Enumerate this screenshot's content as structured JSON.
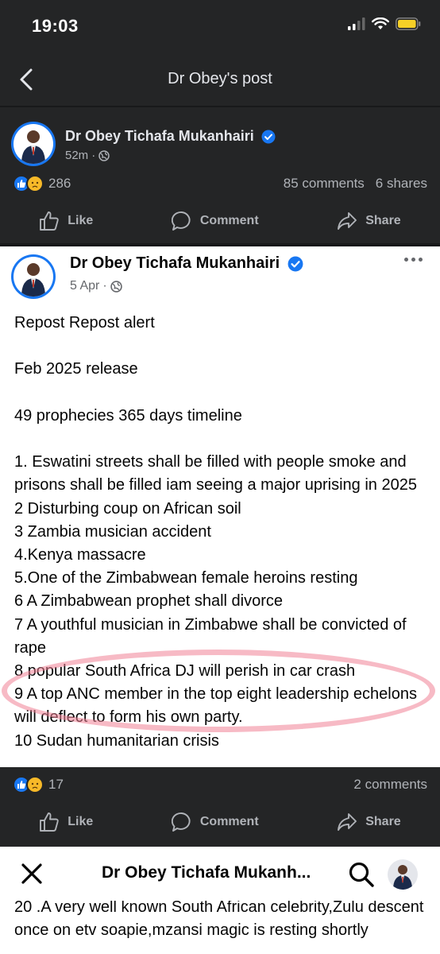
{
  "status_bar": {
    "time": "19:03"
  },
  "header": {
    "title": "Dr Obey's post"
  },
  "post": {
    "author": "Dr Obey Tichafa Mukanhairi",
    "time": "52m",
    "reaction_count": "286",
    "comments": "85 comments",
    "shares": "6 shares"
  },
  "actions": {
    "like": "Like",
    "comment": "Comment",
    "share": "Share"
  },
  "shared_post": {
    "author": "Dr Obey Tichafa Mukanhairi",
    "date": "5 Apr",
    "lines": [
      "Repost Repost alert",
      "",
      "Feb 2025 release",
      "",
      "49 prophecies 365 days timeline",
      "",
      "1. Eswatini streets shall be filled with people smoke and prisons shall be filled iam seeing a major uprising in 2025",
      "2 Disturbing coup on African soil",
      "3 Zambia musician accident",
      "4.Kenya massacre",
      "5.One of the Zimbabwean female heroins resting",
      "6 A Zimbabwean prophet shall divorce",
      "7 A youthful musician in Zimbabwe shall be convicted of rape",
      "8 popular South Africa DJ will perish in car crash",
      "9 A top ANC member in the top eight leadership echelons will deflect to form his own party.",
      "10 Sudan humanitarian crisis"
    ],
    "reaction_count": "17",
    "comments": "2 comments"
  },
  "bottom_bar": {
    "title": "Dr Obey Tichafa Mukanh...",
    "text": "20 .A very well known South African celebrity,Zulu descent once on etv soapie,mzansi magic is resting shortly"
  },
  "colors": {
    "dark_bg": "#242526",
    "accent": "#1877f2",
    "highlight": "#f08296"
  }
}
